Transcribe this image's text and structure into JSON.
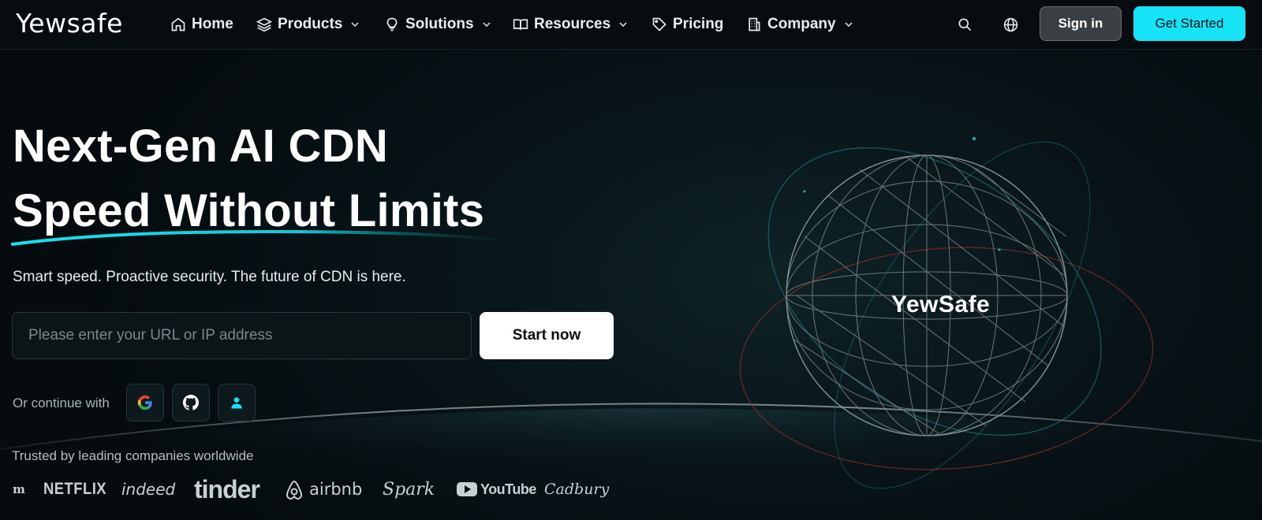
{
  "brand": {
    "logo_text": "Yewsafe"
  },
  "nav": {
    "home": "Home",
    "products": "Products",
    "solutions": "Solutions",
    "resources": "Resources",
    "pricing": "Pricing",
    "company": "Company",
    "sign_in": "Sign in",
    "get_started": "Get Started"
  },
  "hero": {
    "title_line1": "Next-Gen AI CDN",
    "title_line2": "Speed Without Limits",
    "subtitle": "Smart speed. Proactive security. The future of CDN is here.",
    "url_placeholder": "Please enter your URL or IP address",
    "start_button": "Start now",
    "continue_label": "Or continue with",
    "globe_label": "YewSafe"
  },
  "trusted": {
    "label": "Trusted by leading companies worldwide",
    "brands": [
      "m",
      "NETFLIX",
      "indeed",
      "tinder",
      "airbnb",
      "Spark",
      "YouTube",
      "Cadbury"
    ]
  },
  "colors": {
    "accent": "#16e3f5",
    "background": "#050b0e",
    "nav_bg": "#060c0f",
    "signin_bg": "#3a3f43"
  },
  "icons": {
    "home": "home-icon",
    "products": "layers-icon",
    "solutions": "lightbulb-icon",
    "resources": "book-icon",
    "pricing": "tag-icon",
    "company": "building-icon",
    "search": "search-icon",
    "language": "globe-icon"
  }
}
